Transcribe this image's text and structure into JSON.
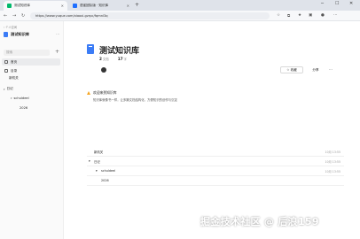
{
  "browser": {
    "tabs": [
      {
        "title": "测试知识库"
      },
      {
        "title": "语雀团队版 · 知识库"
      }
    ],
    "new_tab": "+",
    "url": "https://www.yuque.com/xiaoxi-gzrpc/fqmnl3q",
    "window_controls": {
      "minimize": "─",
      "maximize": "☐",
      "close": "✕"
    }
  },
  "sidebar": {
    "breadcrumb": "‹ 个人空间",
    "kb_title": "测试知识库",
    "search_placeholder": "搜索",
    "nav": [
      {
        "label": "首页"
      },
      {
        "label": "目录"
      }
    ],
    "tree": [
      {
        "label": "新机关"
      },
      {
        "label": "日记"
      },
      {
        "label": "schuldeel"
      },
      {
        "label": "2026"
      }
    ]
  },
  "main": {
    "title": "测试知识库",
    "stats": [
      {
        "value": "2",
        "unit": "文档"
      },
      {
        "value": "17",
        "unit": "字"
      }
    ],
    "buttons": {
      "favorite": "收藏",
      "share": "分享",
      "more": "···"
    },
    "welcome_title": "欢迎来到知识库",
    "welcome_desc": "知识库就像书一样，让多篇文档结构化，方便知识的创作与沉淀",
    "toc": [
      {
        "label": "新机关",
        "date": "10月 13:55"
      },
      {
        "label": "日记",
        "date": "10月 13:55"
      },
      {
        "label": "schuldeel",
        "date": "10月 13:55"
      },
      {
        "label": "2026",
        "date": ""
      }
    ]
  },
  "watermark": "掘金技术社区 @ 后浪159"
}
